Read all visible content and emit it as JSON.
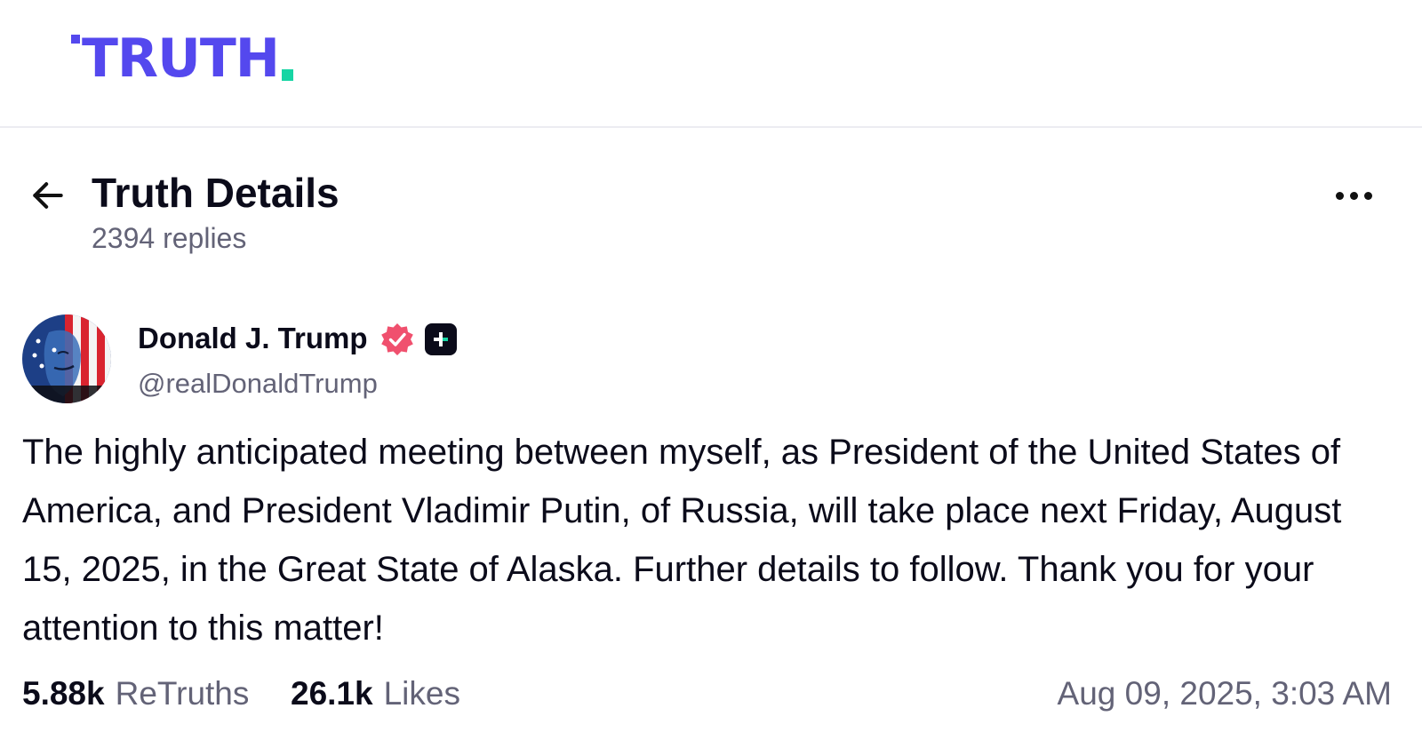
{
  "logo": {
    "text": "TRUTH"
  },
  "header": {
    "title": "Truth Details",
    "replies": "2394 replies"
  },
  "post": {
    "display_name": "Donald J. Trump",
    "handle": "@realDonaldTrump",
    "body": "The highly anticipated meeting between myself, as President of the United States of America, and President Vladimir Putin, of Russia, will take place next Friday, August 15, 2025, in the Great State of Alaska. Further details to follow. Thank you for your attention to this matter!",
    "retruths_count": "5.88k",
    "retruths_label": "ReTruths",
    "likes_count": "26.1k",
    "likes_label": "Likes",
    "timestamp": "Aug 09, 2025, 3:03 AM"
  },
  "colors": {
    "brand": "#5448ee",
    "brand_accent": "#17d5a4",
    "verified": "#f0506e",
    "muted_text": "#636377"
  },
  "icons": {
    "back": "arrow-left-icon",
    "more": "more-horizontal-icon",
    "verified": "verified-badge-icon",
    "plus": "truth-plus-icon"
  }
}
